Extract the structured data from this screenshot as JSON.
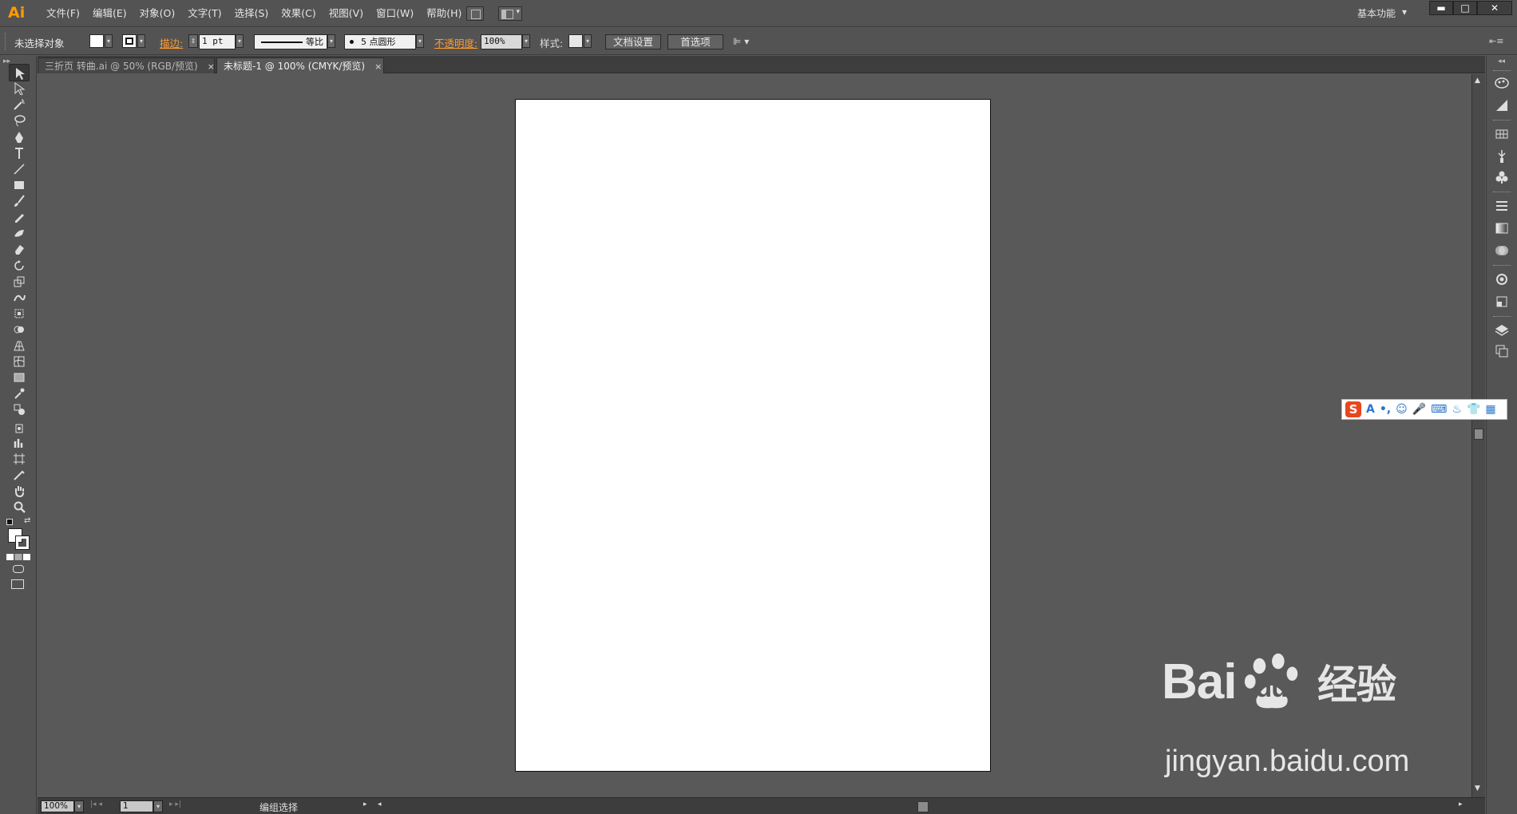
{
  "app": {
    "logo": "Ai",
    "menus": [
      "文件(F)",
      "编辑(E)",
      "对象(O)",
      "文字(T)",
      "选择(S)",
      "效果(C)",
      "视图(V)",
      "窗口(W)",
      "帮助(H)"
    ],
    "workspace": "基本功能",
    "workspace_arrow": "▾",
    "window_controls": {
      "minimize": "▬",
      "maximize": "□",
      "close": "✕"
    }
  },
  "control_bar": {
    "selection_label": "未选择对象",
    "stroke_label": "描边:",
    "stroke_weight": "1 pt",
    "profile_label": "等比",
    "brush_label": "5 点圆形",
    "opacity_label": "不透明度:",
    "opacity_value": "100%",
    "style_label": "样式:",
    "doc_setup_button": "文档设置",
    "preferences_button": "首选项"
  },
  "tabs": [
    {
      "label": "三折页 转曲.ai @ 50% (RGB/预览)",
      "active": false,
      "close": "×"
    },
    {
      "label": "未标题-1 @ 100% (CMYK/预览)",
      "active": true,
      "close": "×"
    }
  ],
  "toolbar": {
    "tools": [
      "selection-tool",
      "direct-selection-tool",
      "magic-wand-tool",
      "lasso-tool",
      "pen-tool",
      "type-tool",
      "line-tool",
      "rectangle-tool",
      "paintbrush-tool",
      "pencil-tool",
      "blob-brush-tool",
      "eraser-tool",
      "rotate-tool",
      "scale-tool",
      "warp-tool",
      "free-transform-tool",
      "shape-builder-tool",
      "perspective-grid-tool",
      "mesh-tool",
      "gradient-tool",
      "eyedropper-tool",
      "blend-tool",
      "symbol-sprayer-tool",
      "column-graph-tool",
      "artboard-tool",
      "slice-tool",
      "hand-tool",
      "zoom-tool"
    ]
  },
  "status_bar": {
    "zoom": "100%",
    "artboard": "1",
    "status_text": "编组选择"
  },
  "ime": {
    "logo": "S",
    "items": [
      "A",
      "•,",
      "☺",
      "🎤",
      "⌨",
      "♨",
      "👕",
      "▦"
    ]
  },
  "watermark": {
    "brand_left": "Bai",
    "brand_right": "du",
    "brand_cn": "经验",
    "url": "jingyan.baidu.com"
  },
  "colors": {
    "accent": "#ff9a00",
    "canvas": "#595959",
    "panel": "#535353"
  }
}
